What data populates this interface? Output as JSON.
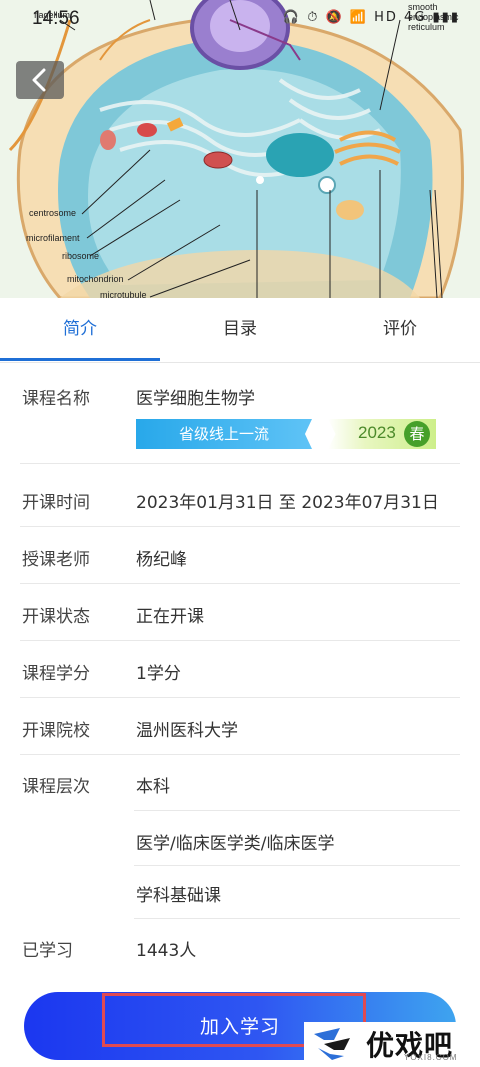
{
  "status_bar": {
    "time": "14:56",
    "icons": "🎧 ⏱ 🔕 📶 HD 4G ▮▮▮"
  },
  "hero": {
    "labels": [
      "flagellum",
      "smooth endoplasmic reticulum",
      "centrosome",
      "microfilament",
      "ribosome",
      "mitochondrion",
      "microtubule"
    ]
  },
  "tabs": [
    "简介",
    "目录",
    "评价"
  ],
  "info": {
    "course_name_label": "课程名称",
    "course_name": "医学细胞生物学",
    "badge_level": "省级线上一流",
    "badge_year": "2023",
    "badge_season": "春",
    "rows": [
      {
        "label": "开课时间",
        "value": "2023年01月31日 至 2023年07月31日"
      },
      {
        "label": "授课老师",
        "value": "杨纪峰"
      },
      {
        "label": "开课状态",
        "value": "正在开课"
      },
      {
        "label": "课程学分",
        "value": "1学分"
      },
      {
        "label": "开课院校",
        "value": "温州医科大学"
      },
      {
        "label": "课程层次",
        "value": "本科"
      },
      {
        "label": "",
        "value": "医学/临床医学类/临床医学"
      },
      {
        "label": "",
        "value": "学科基础课"
      },
      {
        "label": "已学习",
        "value": "1443人"
      }
    ]
  },
  "join_button": "加入学习",
  "watermark": {
    "name": "优戏吧",
    "domain": "YOXI8.COM"
  },
  "colors": {
    "accent": "#1f6fd6",
    "button_start": "#1b37f0",
    "button_end": "#3ea4ef",
    "highlight": "#e04a52"
  }
}
